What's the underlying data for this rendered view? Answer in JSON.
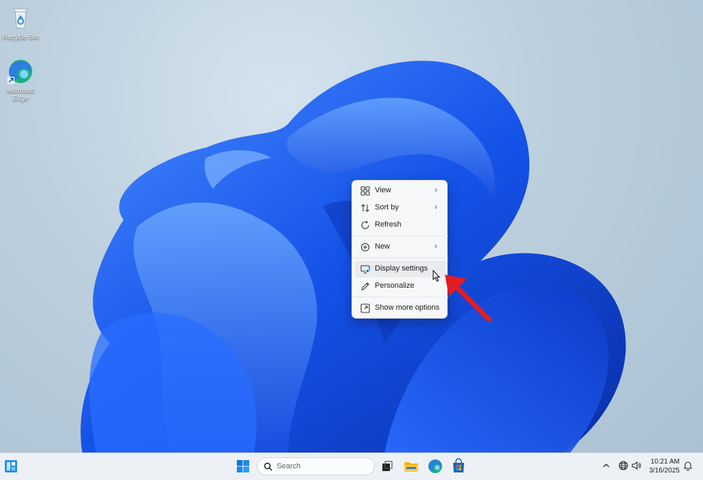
{
  "desktop": {
    "icons": [
      {
        "label": "Recycle Bin",
        "icon": "recycle-bin-icon"
      },
      {
        "label": "Microsoft Edge",
        "icon": "edge-icon"
      }
    ]
  },
  "context_menu": {
    "items": [
      {
        "label": "View",
        "icon": "grid-view-icon",
        "submenu": true
      },
      {
        "label": "Sort by",
        "icon": "sort-icon",
        "submenu": true
      },
      {
        "label": "Refresh",
        "icon": "refresh-icon",
        "submenu": false
      },
      {
        "label": "New",
        "icon": "plus-circle-icon",
        "submenu": true
      },
      {
        "label": "Display settings",
        "icon": "display-icon",
        "submenu": false,
        "hovered": true
      },
      {
        "label": "Personalize",
        "icon": "pencil-icon",
        "submenu": false
      },
      {
        "label": "Show more options",
        "icon": "expand-icon",
        "submenu": false
      }
    ],
    "chevron": "›"
  },
  "taskbar": {
    "search_placeholder": "Search",
    "apps": [
      "start-icon",
      "task-view-icon",
      "file-explorer-icon",
      "edge-icon",
      "store-icon"
    ],
    "time": "10:21 AM",
    "date": "3/16/2025"
  },
  "colors": {
    "accent": "#0067c0",
    "arrow": "#e51c23",
    "bloom": "#1a5bf2"
  }
}
